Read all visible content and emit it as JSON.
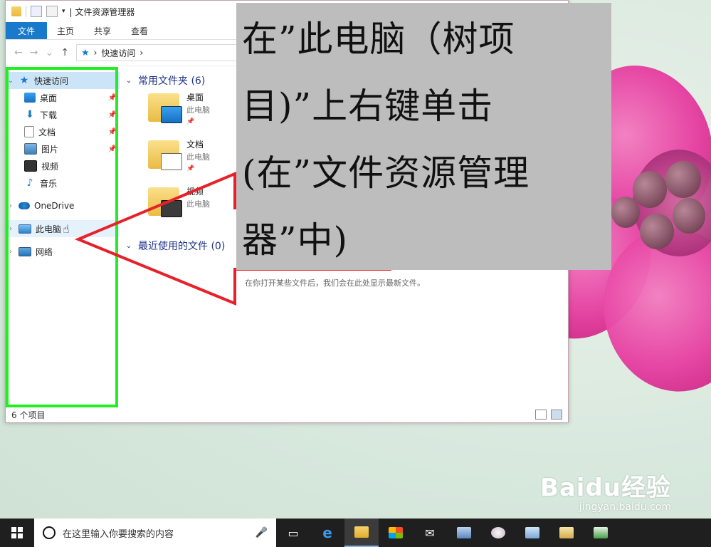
{
  "window": {
    "title": "文件资源管理器",
    "ribbon_tabs": [
      "文件",
      "主页",
      "共享",
      "查看"
    ],
    "address": "快速访问"
  },
  "nav": {
    "items": [
      {
        "label": "快速访问",
        "level": 0
      },
      {
        "label": "桌面",
        "level": 1,
        "pinned": true
      },
      {
        "label": "下载",
        "level": 1,
        "pinned": true
      },
      {
        "label": "文档",
        "level": 1,
        "pinned": true
      },
      {
        "label": "图片",
        "level": 1,
        "pinned": true
      },
      {
        "label": "视频",
        "level": 1
      },
      {
        "label": "音乐",
        "level": 1
      },
      {
        "label": "OneDrive",
        "level": 0
      },
      {
        "label": "此电脑",
        "level": 0
      },
      {
        "label": "网络",
        "level": 0
      }
    ]
  },
  "content": {
    "frequent_header": "常用文件夹 (6)",
    "recent_header": "最近使用的文件 (0)",
    "folders": [
      {
        "name": "桌面",
        "location": "此电脑"
      },
      {
        "name": "文档",
        "location": "此电脑"
      },
      {
        "name": "视频",
        "location": "此电脑"
      }
    ],
    "empty_message": "在你打开某些文件后，我们会在此处显示最新文件。"
  },
  "status": {
    "item_count": "6 个项目"
  },
  "annotation": {
    "lines": [
      "在”此电脑（树项",
      "目)”上右键单击",
      "(在”文件资源管理",
      "器”中)"
    ]
  },
  "taskbar": {
    "search_placeholder": "在这里输入你要搜索的内容"
  },
  "watermark": {
    "logo": "Baidu经验",
    "url": "jingyan.baidu.com"
  },
  "colors": {
    "highlight_box": "#22ee22",
    "arrow": "#e8202a",
    "annotation_bg": "#bdbdbd",
    "ribbon_file": "#1979ca"
  }
}
